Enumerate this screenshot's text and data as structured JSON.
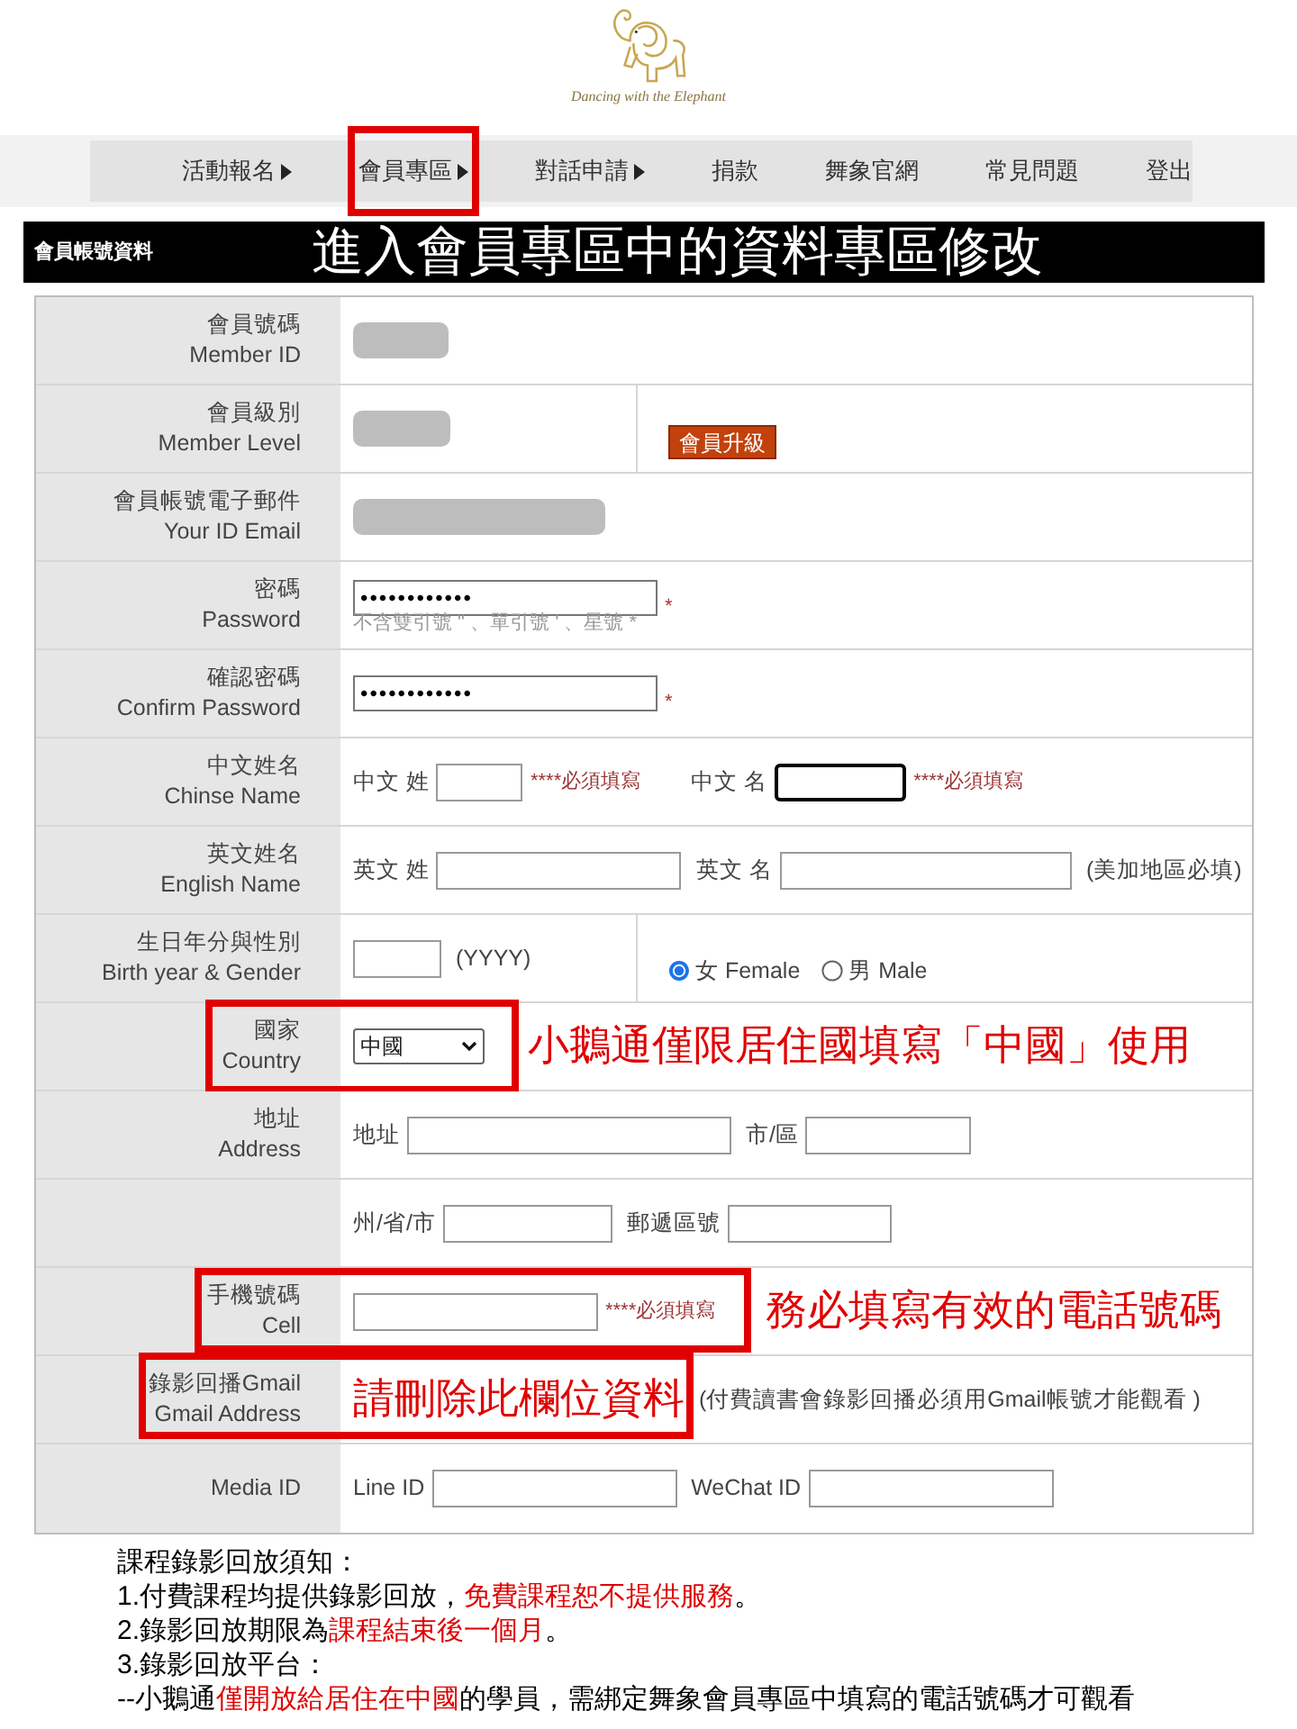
{
  "logo": {
    "text": "Dancing with the Elephant"
  },
  "nav": [
    {
      "label": "活動報名",
      "submenu": true,
      "highlighted": false
    },
    {
      "label": "會員專區",
      "submenu": true,
      "highlighted": true
    },
    {
      "label": "對話申請",
      "submenu": true,
      "highlighted": false
    },
    {
      "label": "捐款",
      "submenu": false,
      "highlighted": false
    },
    {
      "label": "舞象官網",
      "submenu": false,
      "highlighted": false
    },
    {
      "label": "常見問題",
      "submenu": false,
      "highlighted": false
    },
    {
      "label": "登出",
      "submenu": false,
      "highlighted": false
    }
  ],
  "section": {
    "title": "會員帳號資料",
    "annotation": "進入會員專區中的資料專區修改"
  },
  "form_rows": [
    {
      "label_zh": "會員號碼",
      "label_en": "Member ID",
      "highlighted": false,
      "columns": [
        [
          {
            "kind": "masked"
          }
        ]
      ]
    },
    {
      "label_zh": "會員級別",
      "label_en": "Member Level",
      "highlighted": false,
      "columns": [
        [
          {
            "kind": "masked"
          }
        ],
        [
          {
            "kind": "button",
            "label": "會員升級"
          }
        ]
      ]
    },
    {
      "label_zh": "會員帳號電子郵件",
      "label_en": "Your ID Email",
      "highlighted": false,
      "columns": [
        [
          {
            "kind": "masked"
          }
        ]
      ]
    },
    {
      "label_zh": "密碼",
      "label_en": "Password",
      "highlighted": false,
      "columns": [
        [
          {
            "kind": "password",
            "value": "••••••••••••"
          },
          {
            "kind": "required_mark",
            "text": "*"
          },
          {
            "kind": "hint",
            "text": "不含雙引號 \" 、單引號 ' 、星號 *"
          }
        ]
      ]
    },
    {
      "label_zh": "確認密碼",
      "label_en": "Confirm Password",
      "highlighted": false,
      "columns": [
        [
          {
            "kind": "password",
            "value": "••••••••••••"
          },
          {
            "kind": "required_mark",
            "text": "*"
          }
        ]
      ]
    },
    {
      "label_zh": "中文姓名",
      "label_en": "Chinse Name",
      "highlighted": false,
      "columns": [
        [
          {
            "kind": "input",
            "prefix": "中文 姓",
            "focused": false
          },
          {
            "kind": "required_note",
            "text": "****必須填寫"
          },
          {
            "kind": "input",
            "prefix": "中文 名",
            "focused": true
          },
          {
            "kind": "required_note",
            "text": "****必須填寫"
          }
        ]
      ]
    },
    {
      "label_zh": "英文姓名",
      "label_en": "English Name",
      "highlighted": false,
      "columns": [
        [
          {
            "kind": "input",
            "prefix": "英文 姓",
            "focused": false
          },
          {
            "kind": "input",
            "prefix": "英文 名",
            "focused": false
          },
          {
            "kind": "note",
            "text": "(美加地區必填)"
          }
        ]
      ]
    },
    {
      "label_zh": "生日年分與性別",
      "label_en": "Birth year & Gender",
      "highlighted": false,
      "columns": [
        [
          {
            "kind": "input",
            "focused": false
          },
          {
            "kind": "note",
            "text": "(YYYY)"
          }
        ],
        [
          {
            "kind": "radio",
            "label": "女 Female",
            "selected": true
          },
          {
            "kind": "radio",
            "label": "男 Male",
            "selected": false
          }
        ]
      ]
    },
    {
      "label_zh": "國家",
      "label_en": "Country",
      "highlighted": true,
      "columns": [
        [
          {
            "kind": "select",
            "value": "中國"
          },
          {
            "kind": "annotation",
            "text": "小鵝通僅限居住國填寫「中國」使用"
          }
        ]
      ]
    },
    {
      "label_zh": "地址",
      "label_en": "Address",
      "highlighted": false,
      "columns": [
        [
          {
            "kind": "input",
            "prefix": "地址",
            "focused": false
          },
          {
            "kind": "input",
            "prefix": "市/區",
            "focused": false
          }
        ]
      ]
    },
    {
      "highlighted": false,
      "columns": [
        [
          {
            "kind": "input",
            "prefix": "州/省/市",
            "focused": false
          },
          {
            "kind": "input",
            "prefix": "郵遞區號",
            "focused": false
          }
        ]
      ]
    },
    {
      "label_zh": "手機號碼",
      "label_en": "Cell",
      "highlighted": true,
      "columns": [
        [
          {
            "kind": "input",
            "focused": false
          },
          {
            "kind": "required_note",
            "text": "****必須填寫"
          },
          {
            "kind": "annotation",
            "text": "務必填寫有效的電話號碼"
          }
        ]
      ]
    },
    {
      "label_zh": "錄影回播Gmail",
      "label_en": "Gmail Address",
      "highlighted": true,
      "columns": [
        [
          {
            "kind": "annotation",
            "text": "請刪除此欄位資料"
          },
          {
            "kind": "note",
            "text": "(付費讀書會錄影回播必須用Gmail帳號才能觀看 )"
          }
        ]
      ]
    },
    {
      "label_en": "Media ID",
      "highlighted": false,
      "columns": [
        [
          {
            "kind": "input",
            "prefix": "Line ID",
            "focused": false
          },
          {
            "kind": "input",
            "prefix": "WeChat ID",
            "focused": false
          }
        ]
      ]
    }
  ],
  "notes": {
    "title": "課程錄影回放須知：",
    "lines": [
      [
        {
          "text": "1.付費課程均提供錄影回放，",
          "emphasis": false
        },
        {
          "text": "免費課程恕不提供服務",
          "emphasis": true
        },
        {
          "text": "。",
          "emphasis": false
        }
      ],
      [
        {
          "text": "2.錄影回放期限為",
          "emphasis": false
        },
        {
          "text": "課程結束後一個月",
          "emphasis": true
        },
        {
          "text": "。",
          "emphasis": false
        }
      ],
      [
        {
          "text": "3.錄影回放平台：",
          "emphasis": false
        }
      ],
      [
        {
          "text": "--小鵝通",
          "emphasis": false
        },
        {
          "text": "僅開放給居住在中國",
          "emphasis": true
        },
        {
          "text": "的學員，需綁定舞象會員專區中填寫的電話號碼才可觀看",
          "emphasis": false
        }
      ]
    ]
  }
}
